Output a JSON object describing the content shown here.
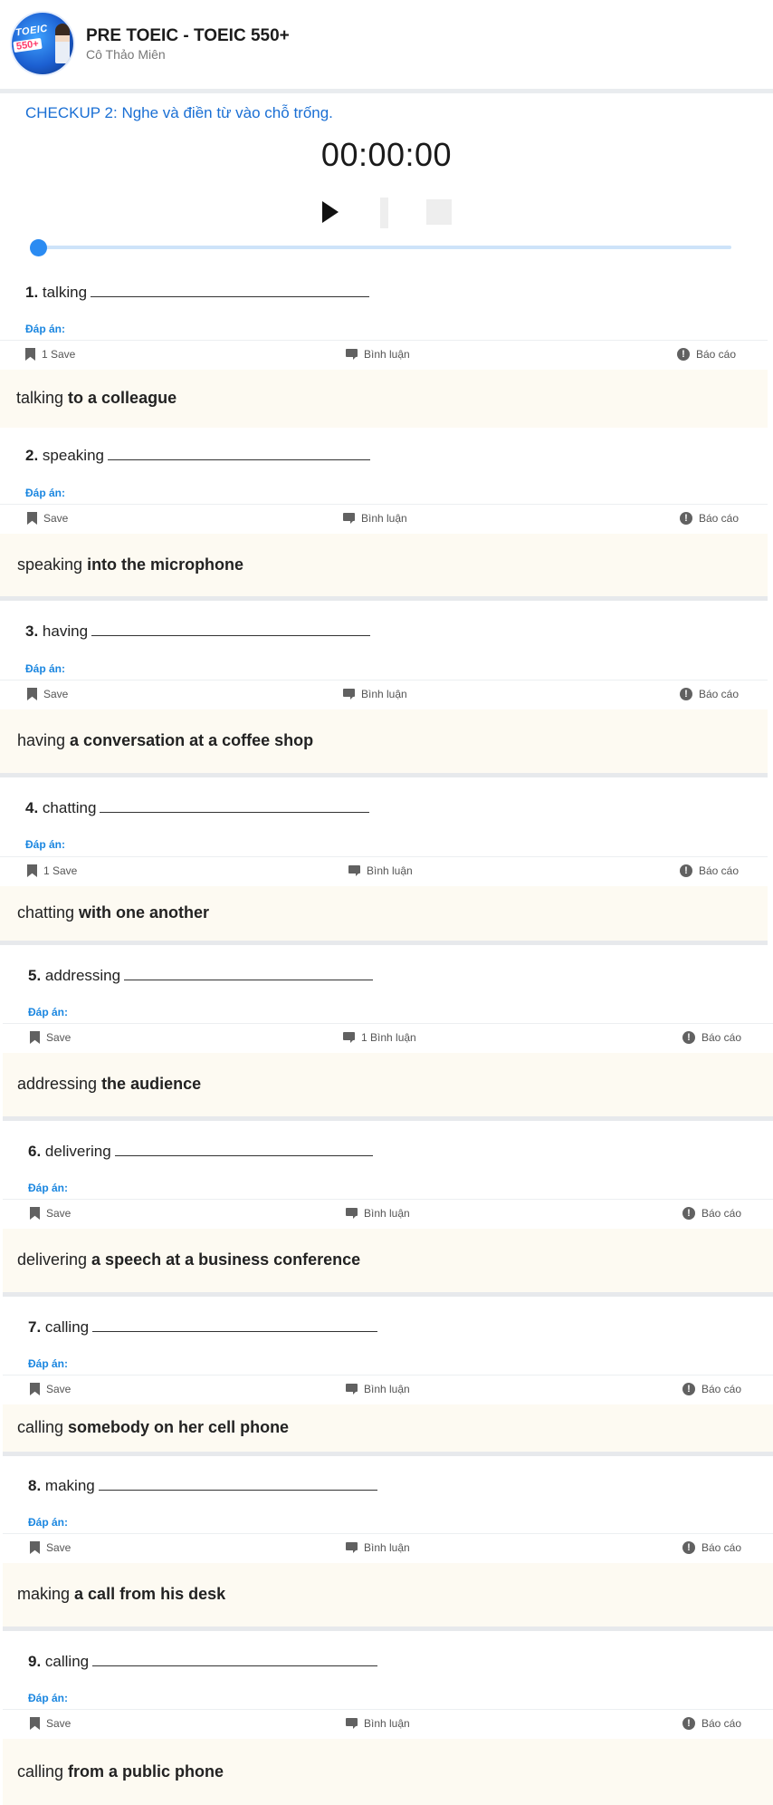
{
  "header": {
    "course_title": "PRE TOEIC - TOEIC 550+",
    "teacher": "Cô Thảo Miên",
    "logo_text_top": "TOEIC",
    "logo_text_bottom": "550+"
  },
  "checkup": {
    "title": "CHECKUP 2: Nghe và điền từ vào chỗ trống."
  },
  "player": {
    "time": "00:00:00",
    "progress": 0
  },
  "labels": {
    "answer_label": "Đáp án:",
    "comment": "Bình luận",
    "report": "Báo cáo"
  },
  "questions": [
    {
      "number": "1.",
      "stem": "talking",
      "save": "1 Save",
      "comment": "Bình luận",
      "answer_prefix": "talking ",
      "answer_bold": "to a colleague"
    },
    {
      "number": "2.",
      "stem": "speaking",
      "save": "Save",
      "comment": "Bình luận",
      "answer_prefix": "speaking ",
      "answer_bold": "into the microphone"
    },
    {
      "number": "3.",
      "stem": "having",
      "save": "Save",
      "comment": "Bình luận",
      "answer_prefix": "having ",
      "answer_bold": "a conversation at a coffee shop"
    },
    {
      "number": "4.",
      "stem": "chatting",
      "save": "1 Save",
      "comment": "Bình luận",
      "answer_prefix": "chatting ",
      "answer_bold": "with one another"
    },
    {
      "number": "5.",
      "stem": "addressing",
      "save": "Save",
      "comment": "1 Bình luận",
      "answer_prefix": "addressing ",
      "answer_bold": "the audience"
    },
    {
      "number": "6.",
      "stem": "delivering",
      "save": "Save",
      "comment": "Bình luận",
      "answer_prefix": "delivering ",
      "answer_bold": "a speech at a business conference"
    },
    {
      "number": "7.",
      "stem": "calling",
      "save": "Save",
      "comment": "Bình luận",
      "answer_prefix": "calling ",
      "answer_bold": "somebody on her cell phone"
    },
    {
      "number": "8.",
      "stem": "making",
      "save": "Save",
      "comment": "Bình luận",
      "answer_prefix": "making ",
      "answer_bold": "a call from his desk"
    },
    {
      "number": "9.",
      "stem": "calling",
      "save": "Save",
      "comment": "Bình luận",
      "answer_prefix": "calling ",
      "answer_bold": "from a public phone"
    }
  ],
  "colors": {
    "accent": "#1a6fd4",
    "answer_label": "#1a86e0",
    "solution_bg": "#fdfaf2",
    "icon": "#616161"
  }
}
